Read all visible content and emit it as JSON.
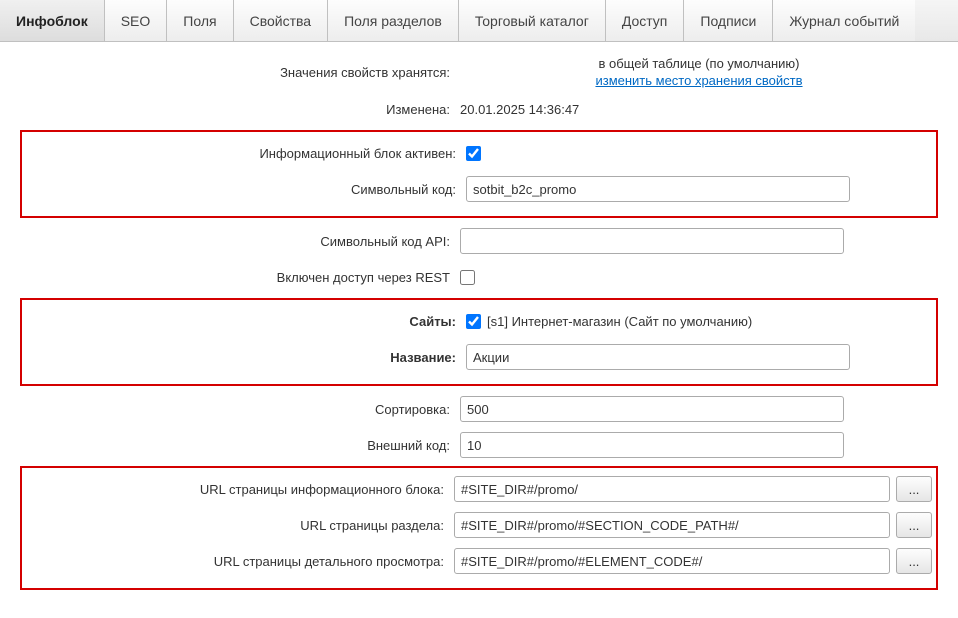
{
  "tabs": {
    "t0": "Инфоблок",
    "t1": "SEO",
    "t2": "Поля",
    "t3": "Свойства",
    "t4": "Поля разделов",
    "t5": "Торговый каталог",
    "t6": "Доступ",
    "t7": "Подписи",
    "t8": "Журнал событий"
  },
  "labels": {
    "props_stored": "Значения свойств хранятся:",
    "changed": "Изменена:",
    "active": "Информационный блок активен:",
    "code": "Символьный код:",
    "api_code": "Символьный код API:",
    "rest": "Включен доступ через REST",
    "sites": "Сайты:",
    "name": "Название:",
    "sort": "Сортировка:",
    "xml_id": "Внешний код:",
    "url_iblock": "URL страницы информационного блока:",
    "url_section": "URL страницы раздела:",
    "url_detail": "URL страницы детального просмотра:"
  },
  "values": {
    "props_stored": "в общей таблице (по умолчанию)",
    "props_change_link": "изменить место хранения свойств",
    "changed": "20.01.2025 14:36:47",
    "active": true,
    "code": "sotbit_b2c_promo",
    "api_code": "",
    "rest": false,
    "site_checked": true,
    "site_label": "[s1] Интернет-магазин (Сайт по умолчанию)",
    "name": "Акции",
    "sort": "500",
    "xml_id": "10",
    "url_iblock": "#SITE_DIR#/promo/",
    "url_section": "#SITE_DIR#/promo/#SECTION_CODE_PATH#/",
    "url_detail": "#SITE_DIR#/promo/#ELEMENT_CODE#/",
    "more_btn": "..."
  }
}
